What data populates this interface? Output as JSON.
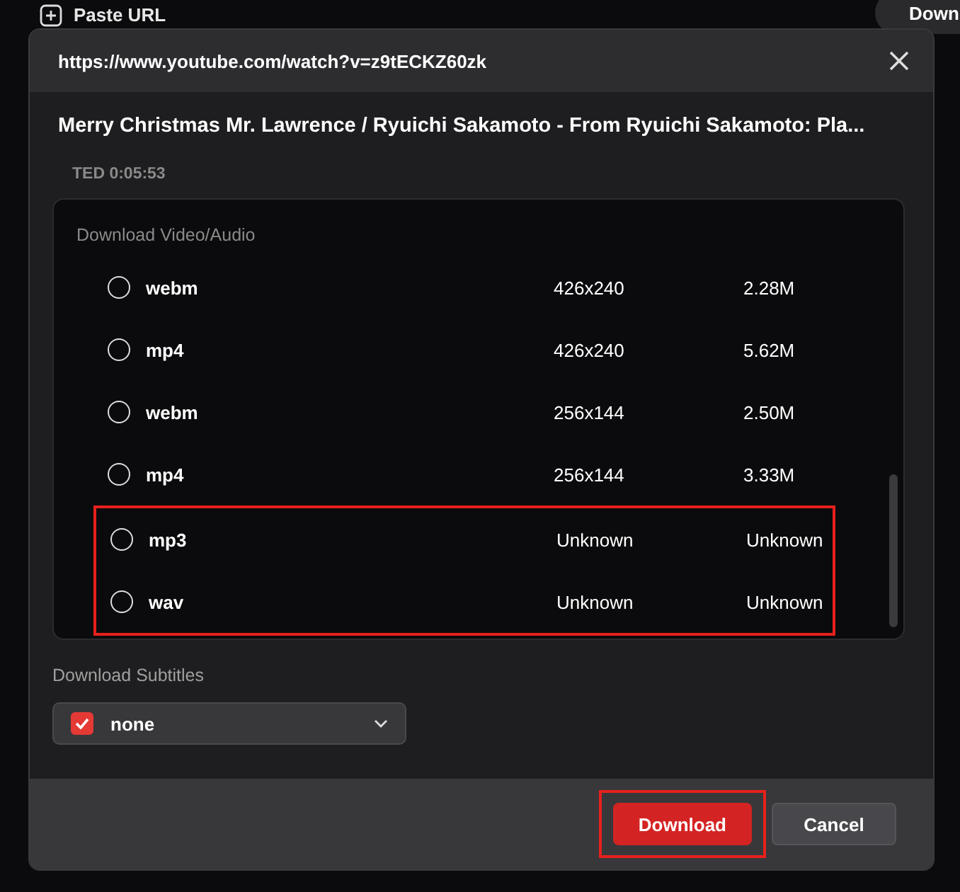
{
  "topbar": {
    "paste_label": "Paste URL",
    "download_button": "Down"
  },
  "dialog": {
    "url": "https://www.youtube.com/watch?v=z9tECKZ60zk",
    "title": "Merry Christmas Mr. Lawrence / Ryuichi Sakamoto - From Ryuichi Sakamoto: Pla...",
    "meta": "TED 0:05:53",
    "section_label": "Download Video/Audio",
    "formats": [
      {
        "format": "webm",
        "resolution": "426x240",
        "size": "2.28M",
        "selected": false,
        "highlighted": false
      },
      {
        "format": "mp4",
        "resolution": "426x240",
        "size": "5.62M",
        "selected": false,
        "highlighted": false
      },
      {
        "format": "webm",
        "resolution": "256x144",
        "size": "2.50M",
        "selected": false,
        "highlighted": false
      },
      {
        "format": "mp4",
        "resolution": "256x144",
        "size": "3.33M",
        "selected": false,
        "highlighted": false
      },
      {
        "format": "mp3",
        "resolution": "Unknown",
        "size": "Unknown",
        "selected": false,
        "highlighted": true
      },
      {
        "format": "wav",
        "resolution": "Unknown",
        "size": "Unknown",
        "selected": false,
        "highlighted": true
      }
    ],
    "subtitles_label": "Download Subtitles",
    "subtitles": {
      "value": "none",
      "checked": true
    },
    "buttons": [
      {
        "label": "Download",
        "kind": "primary",
        "highlighted": true
      },
      {
        "label": "Cancel",
        "kind": "secondary",
        "highlighted": false
      }
    ]
  }
}
